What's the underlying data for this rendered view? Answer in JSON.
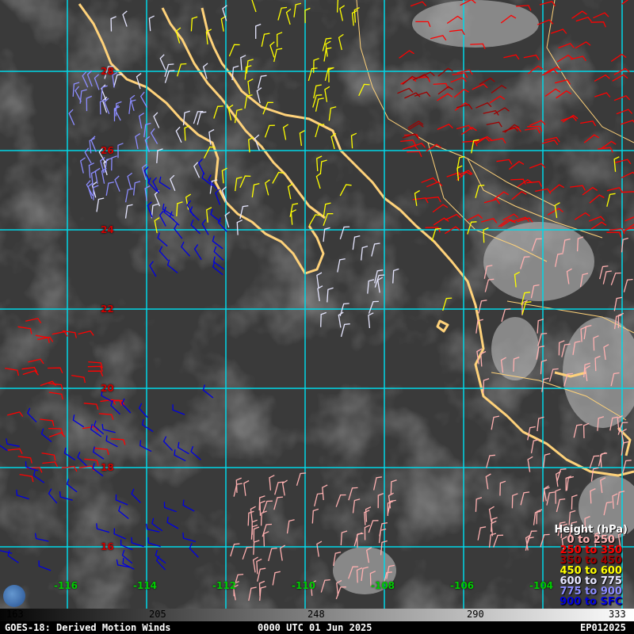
{
  "map": {
    "lat_labels": [
      "28",
      "26",
      "24",
      "22",
      "20",
      "18",
      "16"
    ],
    "lon_labels": [
      "-116",
      "-114",
      "-112",
      "-110",
      "-108",
      "-106",
      "-104"
    ],
    "colors": {
      "grid": "#00d8e8",
      "coast": "#ffd27a",
      "height_0_250": "#ffb0b0",
      "height_250_350": "#ff0000",
      "height_350_450": "#a00000",
      "height_450_600": "#ffff00",
      "height_600_775": "#e6e6ff",
      "height_775_900": "#8c8cff",
      "height_900_sfc": "#0000e0"
    }
  },
  "legend": {
    "title": "Height (hPa)",
    "items": [
      {
        "label": "0 to 250",
        "color": "#ffb0b0"
      },
      {
        "label": "250 to 350",
        "color": "#ff0000"
      },
      {
        "label": "350 to 450",
        "color": "#a00000"
      },
      {
        "label": "450 to 600",
        "color": "#ffff00"
      },
      {
        "label": "600 to 775",
        "color": "#e6e6ff"
      },
      {
        "label": "775 to 900",
        "color": "#8c8cff"
      },
      {
        "label": "900 to SFC",
        "color": "#0000e0"
      }
    ]
  },
  "colorbar": {
    "ticks": [
      "163",
      "205",
      "248",
      "290",
      "333"
    ]
  },
  "footer": {
    "left": "GOES-18: Derived Motion Winds",
    "center": "0000 UTC 01 Jun 2025",
    "right": "EP012025"
  }
}
